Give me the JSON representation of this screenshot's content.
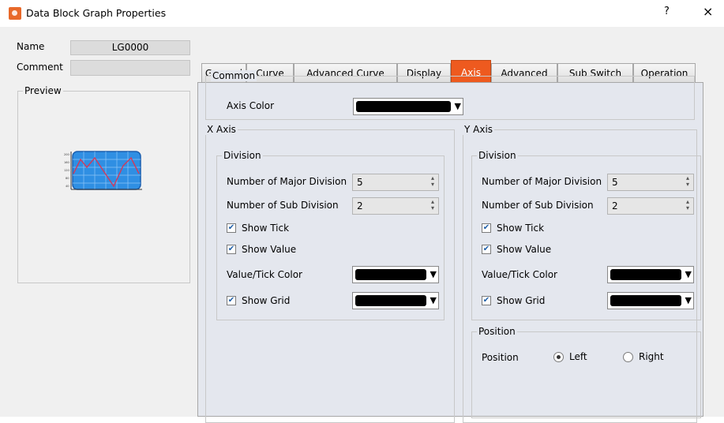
{
  "window": {
    "title": "Data Block Graph Properties",
    "help": "?",
    "close": "×"
  },
  "left": {
    "name_label": "Name",
    "name_value": "LG0000",
    "comment_label": "Comment",
    "comment_value": "",
    "preview_label": "Preview"
  },
  "tabs": [
    {
      "label": "General"
    },
    {
      "label": "Curve"
    },
    {
      "label": "Advanced Curve"
    },
    {
      "label": "Display"
    },
    {
      "label": "Axis"
    },
    {
      "label": "Advanced"
    },
    {
      "label": "Sub Switch"
    },
    {
      "label": "Operation"
    }
  ],
  "active_tab": "Axis",
  "common": {
    "title": "Common",
    "axis_color_label": "Axis Color",
    "axis_color": "#000000"
  },
  "x_axis": {
    "title": "X Axis",
    "division_title": "Division",
    "major_label": "Number of Major Division",
    "major_value": "5",
    "sub_label": "Number of Sub Division",
    "sub_value": "2",
    "show_tick": "Show Tick",
    "show_value": "Show Value",
    "tick_color_label": "Value/Tick Color",
    "show_grid": "Show Grid"
  },
  "y_axis": {
    "title": "Y Axis",
    "division_title": "Division",
    "major_label": "Number of Major Division",
    "major_value": "5",
    "sub_label": "Number of Sub Division",
    "sub_value": "2",
    "show_tick": "Show Tick",
    "show_value": "Show Value",
    "tick_color_label": "Value/Tick Color",
    "show_grid": "Show Grid",
    "position_group": "Position",
    "position_label": "Position",
    "left": "Left",
    "right": "Right"
  },
  "colors": {
    "accent": "#ee5a1f",
    "panel": "#e4e7ee",
    "swatch": "#000000"
  },
  "icons": {
    "check": "✔",
    "dropdown": "▼",
    "spin_up": "⌃",
    "spin_down": "⌄"
  }
}
